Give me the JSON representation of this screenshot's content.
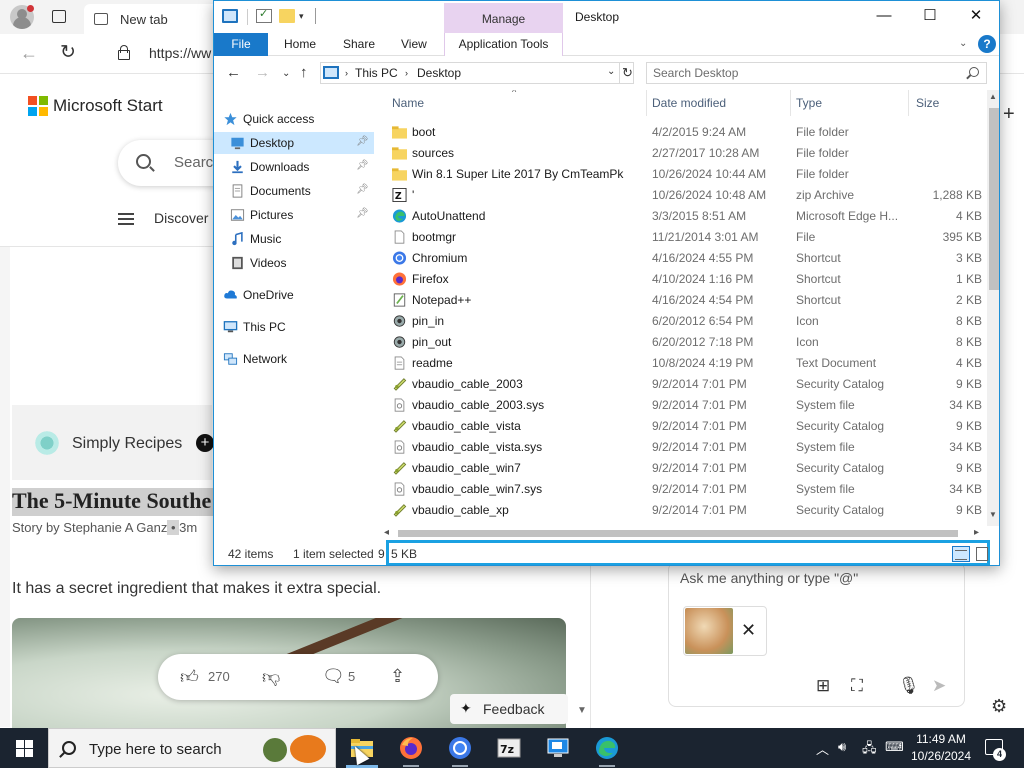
{
  "browser": {
    "tab_title": "New tab",
    "url": "https://ww",
    "brand": "Microsoft Start",
    "search_placeholder": "Searc",
    "discover_label": "Discover",
    "publisher": "Simply Recipes",
    "article_title": "The 5-Minute Southe",
    "byline_prefix": "Story by Stephanie A Ganz",
    "byline_sep": " • ",
    "byline_suffix": "3m",
    "article_body": "It has a secret ingredient that makes it extra special.",
    "likes": "270",
    "comments": "5",
    "feedback_label": "Feedback"
  },
  "copilot": {
    "placeholder": "Ask me anything or type \"@\""
  },
  "explorer": {
    "context_tab": "Manage",
    "window_title": "Desktop",
    "ribbon_tabs": [
      "File",
      "Home",
      "Share",
      "View",
      "Application Tools"
    ],
    "address": [
      "This PC",
      "Desktop"
    ],
    "search_placeholder": "Search Desktop",
    "nav": [
      {
        "label": "Quick access",
        "icon": "star-icon",
        "pinned": false,
        "selected": false
      },
      {
        "label": "Desktop",
        "icon": "desktop-icon",
        "pinned": true,
        "selected": true
      },
      {
        "label": "Downloads",
        "icon": "download-icon",
        "pinned": true,
        "selected": false
      },
      {
        "label": "Documents",
        "icon": "document-icon",
        "pinned": true,
        "selected": false
      },
      {
        "label": "Pictures",
        "icon": "pictures-icon",
        "pinned": true,
        "selected": false
      },
      {
        "label": "Music",
        "icon": "music-icon",
        "pinned": false,
        "selected": false
      },
      {
        "label": "Videos",
        "icon": "videos-icon",
        "pinned": false,
        "selected": false
      },
      {
        "label": "OneDrive",
        "icon": "cloud-icon",
        "pinned": false,
        "selected": false
      },
      {
        "label": "This PC",
        "icon": "pc-icon",
        "pinned": false,
        "selected": false
      },
      {
        "label": "Network",
        "icon": "network-icon",
        "pinned": false,
        "selected": false
      }
    ],
    "columns": [
      "Name",
      "Date modified",
      "Type",
      "Size"
    ],
    "files": [
      {
        "name": "boot",
        "date": "4/2/2015 9:24 AM",
        "type": "File folder",
        "size": "",
        "icon": "folder-icon"
      },
      {
        "name": "sources",
        "date": "2/27/2017 10:28 AM",
        "type": "File folder",
        "size": "",
        "icon": "folder-icon"
      },
      {
        "name": "Win 8.1 Super Lite 2017 By CmTeamPk",
        "date": "10/26/2024 10:44 AM",
        "type": "File folder",
        "size": "",
        "icon": "folder-icon"
      },
      {
        "name": "'",
        "date": "10/26/2024 10:48 AM",
        "type": "zip Archive",
        "size": "1,288 KB",
        "icon": "zip-icon"
      },
      {
        "name": "AutoUnattend",
        "date": "3/3/2015 8:51 AM",
        "type": "Microsoft Edge H...",
        "size": "4 KB",
        "icon": "edge-icon"
      },
      {
        "name": "bootmgr",
        "date": "11/21/2014 3:01 AM",
        "type": "File",
        "size": "395 KB",
        "icon": "file-icon"
      },
      {
        "name": "Chromium",
        "date": "4/16/2024 4:55 PM",
        "type": "Shortcut",
        "size": "3 KB",
        "icon": "chromium-icon"
      },
      {
        "name": "Firefox",
        "date": "4/10/2024 1:16 PM",
        "type": "Shortcut",
        "size": "1 KB",
        "icon": "firefox-icon"
      },
      {
        "name": "Notepad++",
        "date": "4/16/2024 4:54 PM",
        "type": "Shortcut",
        "size": "2 KB",
        "icon": "notepadpp-icon"
      },
      {
        "name": "pin_in",
        "date": "6/20/2012 6:54 PM",
        "type": "Icon",
        "size": "8 KB",
        "icon": "pin-icon"
      },
      {
        "name": "pin_out",
        "date": "6/20/2012 7:18 PM",
        "type": "Icon",
        "size": "8 KB",
        "icon": "pin-icon"
      },
      {
        "name": "readme",
        "date": "10/8/2024 4:19 PM",
        "type": "Text Document",
        "size": "4 KB",
        "icon": "text-file-icon"
      },
      {
        "name": "vbaudio_cable_2003",
        "date": "9/2/2014 7:01 PM",
        "type": "Security Catalog",
        "size": "9 KB",
        "icon": "catalog-icon"
      },
      {
        "name": "vbaudio_cable_2003.sys",
        "date": "9/2/2014 7:01 PM",
        "type": "System file",
        "size": "34 KB",
        "icon": "sys-file-icon"
      },
      {
        "name": "vbaudio_cable_vista",
        "date": "9/2/2014 7:01 PM",
        "type": "Security Catalog",
        "size": "9 KB",
        "icon": "catalog-icon"
      },
      {
        "name": "vbaudio_cable_vista.sys",
        "date": "9/2/2014 7:01 PM",
        "type": "System file",
        "size": "34 KB",
        "icon": "sys-file-icon"
      },
      {
        "name": "vbaudio_cable_win7",
        "date": "9/2/2014 7:01 PM",
        "type": "Security Catalog",
        "size": "9 KB",
        "icon": "catalog-icon"
      },
      {
        "name": "vbaudio_cable_win7.sys",
        "date": "9/2/2014 7:01 PM",
        "type": "System file",
        "size": "34 KB",
        "icon": "sys-file-icon"
      },
      {
        "name": "vbaudio_cable_xp",
        "date": "9/2/2014 7:01 PM",
        "type": "Security Catalog",
        "size": "9 KB",
        "icon": "catalog-icon"
      }
    ],
    "status": {
      "items": "42 items",
      "selected": "1 item selected",
      "size_prefix": "9",
      "size_value": "5 KB"
    }
  },
  "taskbar": {
    "search_placeholder": "Type here to search",
    "time": "11:49 AM",
    "date": "10/26/2024",
    "notifications": "4",
    "apps": [
      "file-explorer-icon",
      "firefox-icon",
      "chromium-icon",
      "7zip-icon",
      "remote-desktop-icon",
      "edge-icon"
    ]
  },
  "colors": {
    "accent": "#1979ca",
    "selection": "#cce8ff",
    "manage_tab": "#e8d3f0",
    "highlight_box": "#1ba1e2",
    "taskbar": "#1b2430"
  }
}
